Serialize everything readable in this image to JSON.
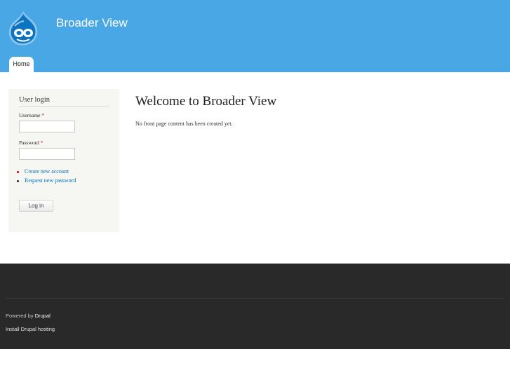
{
  "header": {
    "site_name": "Broader View",
    "logo_icon": "drupal-drop-icon",
    "background": "#4aa7e6"
  },
  "nav": {
    "tabs": [
      {
        "label": "Home"
      }
    ]
  },
  "login_block": {
    "title": "User login",
    "username_label": "Username",
    "password_label": "Password",
    "required_marker": "*",
    "links": [
      {
        "label": "Create new account",
        "bullet_color": "#c00000"
      },
      {
        "label": "Request new password",
        "bullet_color": "#222222"
      }
    ],
    "submit_label": "Log in"
  },
  "main": {
    "title": "Welcome to Broader View",
    "text": "No front page content has been created yet."
  },
  "footer": {
    "powered_prefix": "Powered by ",
    "powered_link": "Drupal",
    "hosting_link": "Install Drupal hosting",
    "background": "#292929"
  }
}
